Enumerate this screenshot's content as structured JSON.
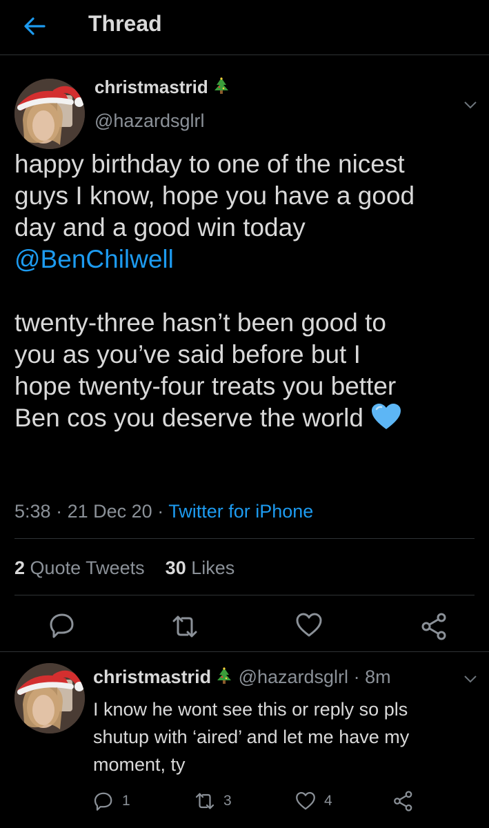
{
  "header": {
    "title": "Thread"
  },
  "tweet": {
    "author_name": "christmastrid",
    "handle": "@hazardsglrl",
    "text_lines": [
      "happy birthday to one of the nicest",
      "guys I know, hope you have a good",
      "day and a good win today"
    ],
    "mention": "@BenChilwell",
    "text2_lines": [
      "twenty-three hasn’t been good to",
      "you as you’ve said before but I",
      "hope twenty-four treats you better",
      "Ben cos you deserve the world"
    ],
    "time": "5:38",
    "date": "21 Dec 20",
    "separator": "·",
    "source": "Twitter for iPhone",
    "quote_tweets_count": "2",
    "quote_tweets_label": "Quote Tweets",
    "likes_count": "30",
    "likes_label": "Likes",
    "colors": {
      "link": "#1d9bf0",
      "muted": "#8b9198",
      "text": "#d9d9d9",
      "background": "#000000"
    }
  },
  "reply": {
    "author_name": "christmastrid",
    "handle": "@hazardsglrl",
    "separator": "·",
    "age": "8m",
    "text": "I know he wont see this or reply so pls shutup with ‘aired’ and let me have my moment, ty",
    "reply_count": "1",
    "retweet_count": "3",
    "like_count": "4"
  },
  "icons": {
    "back": "arrow-left-icon",
    "tree": "christmas-tree-icon",
    "heart": "blue-heart-icon",
    "reply": "reply-icon",
    "retweet": "retweet-icon",
    "like": "like-icon",
    "share": "share-icon",
    "more": "chevron-down-icon"
  }
}
